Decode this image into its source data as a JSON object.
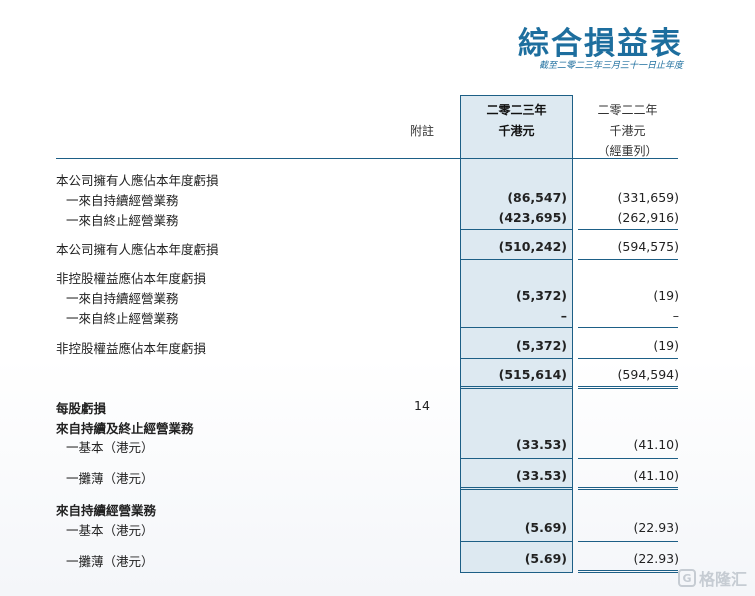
{
  "title": "綜合損益表",
  "subtitle": "截至二零二三年三月三十一日止年度",
  "headers": {
    "note": "附註",
    "current_year": "二零二三年",
    "current_unit": "千港元",
    "prior_year": "二零二二年",
    "prior_unit": "千港元",
    "prior_note": "（經重列）"
  },
  "rows": [
    {
      "label": "本公司擁有人應佔本年度虧損",
      "note": "",
      "current": "",
      "prior": ""
    },
    {
      "label": "一來自持續經營業務",
      "note": "",
      "current": "(86,547)",
      "prior": "(331,659)"
    },
    {
      "label": "一來自終止經營業務",
      "note": "",
      "current": "(423,695)",
      "prior": "(262,916)"
    },
    {
      "label": "本公司擁有人應佔本年度虧損",
      "note": "",
      "current": "(510,242)",
      "prior": "(594,575)"
    },
    {
      "label": "非控股權益應佔本年度虧損",
      "note": "",
      "current": "",
      "prior": ""
    },
    {
      "label": "一來自持續經營業務",
      "note": "",
      "current": "(5,372)",
      "prior": "(19)"
    },
    {
      "label": "一來自終止經營業務",
      "note": "",
      "current": "–",
      "prior": "–"
    },
    {
      "label": "非控股權益應佔本年度虧損",
      "note": "",
      "current": "(5,372)",
      "prior": "(19)"
    },
    {
      "label": "",
      "note": "",
      "current": "(515,614)",
      "prior": "(594,594)"
    },
    {
      "label": "每股虧損",
      "note": "14",
      "current": "",
      "prior": ""
    },
    {
      "label": "來自持續及終止經營業務",
      "note": "",
      "current": "",
      "prior": ""
    },
    {
      "label": "一基本（港元）",
      "note": "",
      "current": "(33.53)",
      "prior": "(41.10)"
    },
    {
      "label": "一攤薄（港元）",
      "note": "",
      "current": "(33.53)",
      "prior": "(41.10)"
    },
    {
      "label": "來自持續經營業務",
      "note": "",
      "current": "",
      "prior": ""
    },
    {
      "label": "一基本（港元）",
      "note": "",
      "current": "(5.69)",
      "prior": "(22.93)"
    },
    {
      "label": "一攤薄（港元）",
      "note": "",
      "current": "(5.69)",
      "prior": "(22.93)"
    }
  ],
  "watermark": "格隆汇"
}
